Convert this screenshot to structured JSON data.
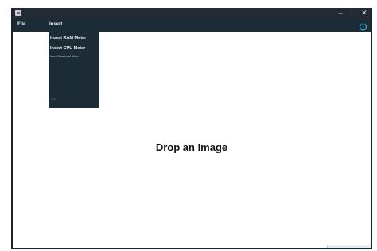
{
  "window": {
    "controls": {
      "minimize": "–",
      "maximize": "□",
      "close": "✕"
    }
  },
  "menubar": {
    "file_label": "File",
    "insert_label": "Insert"
  },
  "insert_menu": {
    "items": [
      "Insert RAM Meter",
      "Insert CPU Meter",
      "Insert Download Meter"
    ],
    "footer_label": "Insert"
  },
  "main": {
    "drop_text": "Drop an Image"
  },
  "colors": {
    "titlebar": "#232a31",
    "menubar": "#1c2c37",
    "accent": "#3fa3d6"
  },
  "icons": {
    "app": "app-icon",
    "power": "power-icon"
  }
}
